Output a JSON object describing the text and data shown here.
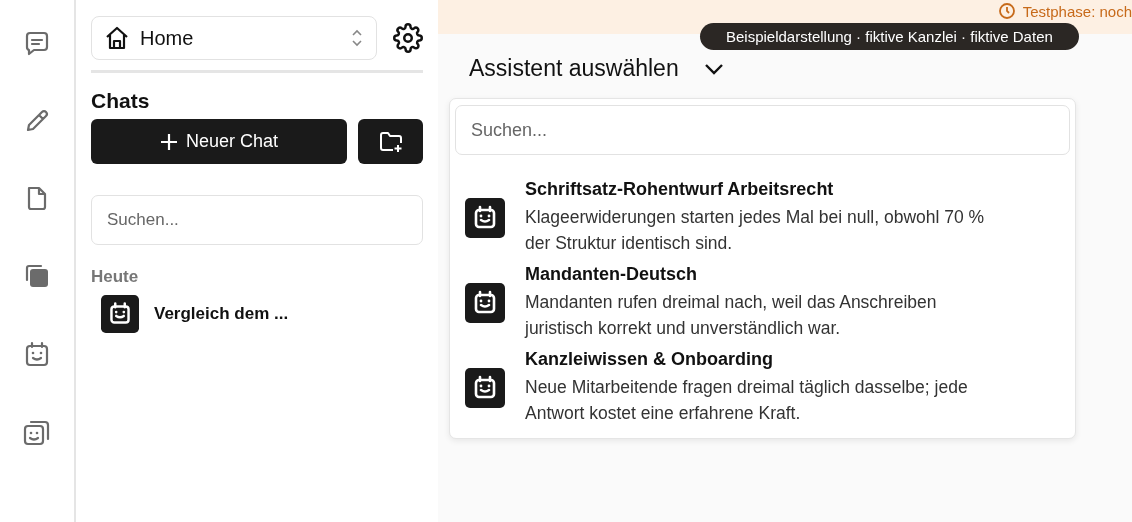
{
  "rail": [
    {
      "kind": "chat"
    },
    {
      "kind": "pencil"
    },
    {
      "kind": "file"
    },
    {
      "kind": "stack"
    },
    {
      "kind": "bot"
    },
    {
      "kind": "bots"
    }
  ],
  "sidebar": {
    "workspace": "Home",
    "heading": "Chats",
    "new_chat": "Neuer Chat",
    "search": {
      "placeholder": "Suchen..."
    },
    "groups": [
      {
        "label": "Heute",
        "items": [
          {
            "title": "Vergleich dem ..."
          }
        ]
      }
    ]
  },
  "banner": {
    "text": "Testphase: noch"
  },
  "badge": "Beispieldarstellung · fiktive Kanzlei · fiktive Daten",
  "assistant_picker": {
    "label": "Assistent auswählen",
    "expanded": true,
    "search": {
      "placeholder": "Suchen..."
    },
    "options": [
      {
        "title": "Schriftsatz-Rohentwurf Arbeitsrecht",
        "description": "Klageerwiderungen starten jedes Mal bei null, obwohl 70 % der Struktur identisch sind."
      },
      {
        "title": "Mandanten-Deutsch",
        "description": "Mandanten rufen dreimal nach, weil das Anschreiben juristisch korrekt und unverständlich war."
      },
      {
        "title": "Kanzleiwissen & Onboarding",
        "description": "Neue Mitarbeitende fragen dreimal täglich dasselbe; jede Antwort kostet eine erfahrene Kraft."
      }
    ]
  }
}
